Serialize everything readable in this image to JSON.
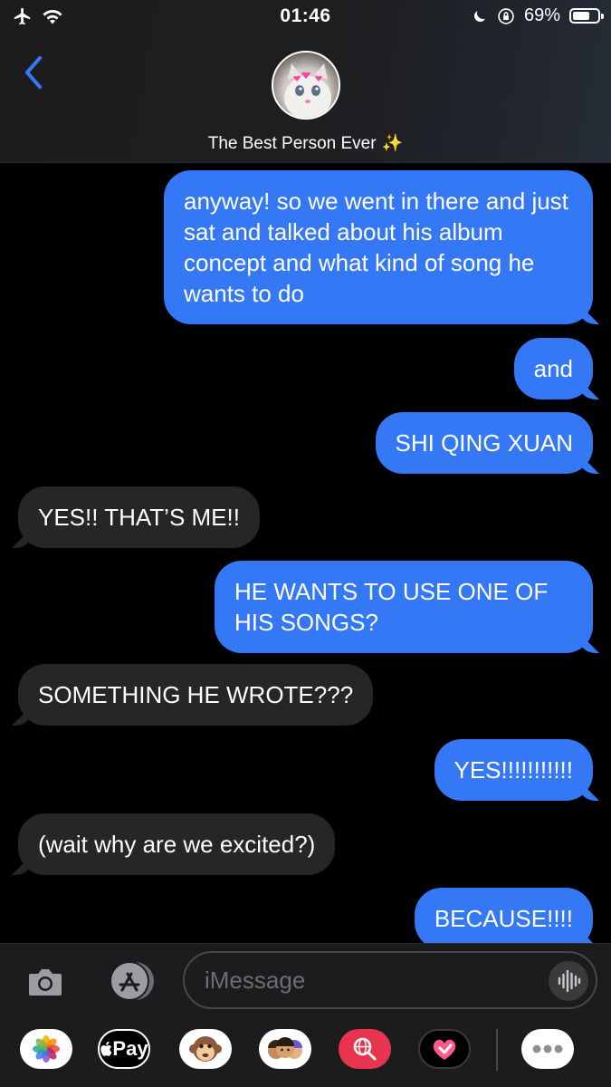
{
  "status_bar": {
    "time": "01:46",
    "battery_percent": "69%",
    "battery_level": 0.69,
    "icons": [
      "airplane-icon",
      "wifi-icon",
      "moon-icon",
      "orientation-lock-icon",
      "battery-icon"
    ]
  },
  "header": {
    "contact_name": "The Best Person Ever",
    "contact_emoji": "✨"
  },
  "messages": [
    {
      "from": "me",
      "text": "anyway! so we went in there and just sat and talked about his album concept and what kind of song he wants to do"
    },
    {
      "from": "me",
      "text": "and"
    },
    {
      "from": "me",
      "text": "SHI QING XUAN"
    },
    {
      "from": "them",
      "text": "YES!! THAT’S ME!!"
    },
    {
      "from": "me",
      "text": "HE WANTS TO USE ONE OF HIS SONGS?"
    },
    {
      "from": "them",
      "text": "SOMETHING HE WROTE???"
    },
    {
      "from": "me",
      "text": "YES!!!!!!!!!!!"
    },
    {
      "from": "them",
      "text": "(wait why are we excited?)"
    },
    {
      "from": "me",
      "text": "BECAUSE!!!!"
    }
  ],
  "composer": {
    "placeholder": "iMessage",
    "value": ""
  },
  "app_drawer": [
    {
      "name": "photos-app-icon"
    },
    {
      "name": "apple-pay-app-icon",
      "label": "Pay"
    },
    {
      "name": "animoji-app-icon"
    },
    {
      "name": "memoji-app-icon"
    },
    {
      "name": "image-search-app-icon"
    },
    {
      "name": "digital-touch-app-icon"
    },
    {
      "name": "more-apps-icon"
    }
  ],
  "colors": {
    "sent_bubble": "#3478f6",
    "received_bubble": "#262628",
    "accent": "#2f7cf6",
    "background": "#000000"
  }
}
